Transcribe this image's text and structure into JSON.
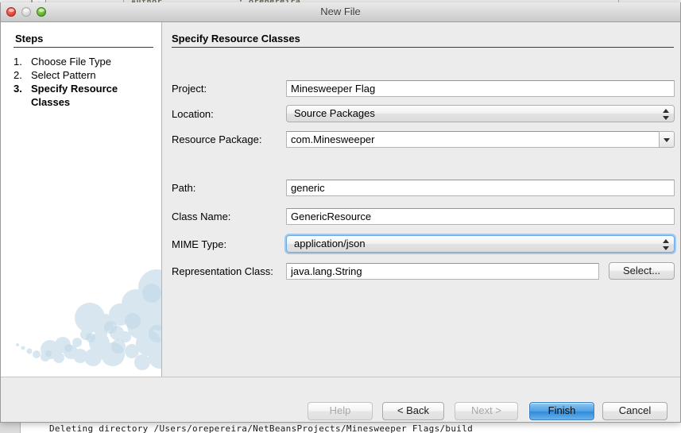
{
  "background_window": {
    "column_author_label": "Author",
    "column_author_value": ": orepereira",
    "log_line": "Deleting directory /Users/orepereira/NetBeansProjects/Minesweeper Flags/build"
  },
  "window": {
    "title": "New File",
    "traffic_lights": {
      "close": "close-button",
      "minimize": "minimize-button",
      "zoom": "zoom-button"
    }
  },
  "sidebar": {
    "heading": "Steps",
    "steps": [
      {
        "number": "1.",
        "label": "Choose File Type",
        "current": false
      },
      {
        "number": "2.",
        "label": "Select Pattern",
        "current": false
      },
      {
        "number": "3.",
        "label": "Specify Resource Classes",
        "current": true
      }
    ]
  },
  "main": {
    "title": "Specify Resource Classes",
    "fields": {
      "project": {
        "label": "Project:",
        "value": "Minesweeper Flag",
        "type": "text"
      },
      "location": {
        "label": "Location:",
        "value": "Source Packages",
        "type": "popup"
      },
      "resource_package": {
        "label": "Resource Package:",
        "value": "com.Minesweeper",
        "type": "combo-editable"
      },
      "path": {
        "label": "Path:",
        "value": "generic",
        "type": "text"
      },
      "class_name": {
        "label": "Class Name:",
        "value": "GenericResource",
        "type": "text"
      },
      "mime_type": {
        "label": "MIME Type:",
        "value": "application/json",
        "type": "popup",
        "focused": true
      },
      "representation_class": {
        "label": "Representation Class:",
        "value": "java.lang.String",
        "type": "text"
      }
    },
    "select_button": "Select..."
  },
  "buttons": {
    "help": {
      "label": "Help",
      "disabled": true
    },
    "back": {
      "label": "< Back",
      "disabled": false
    },
    "next": {
      "label": "Next >",
      "disabled": true
    },
    "finish": {
      "label": "Finish",
      "disabled": false,
      "default": true
    },
    "cancel": {
      "label": "Cancel",
      "disabled": false
    }
  },
  "colors": {
    "accent_blue": "#2f8ada",
    "focus_ring": "#6aaae4",
    "dialog_bg": "#ececec",
    "sidebar_bg": "#ffffff",
    "bubble_blue": "#cfe0ec"
  }
}
